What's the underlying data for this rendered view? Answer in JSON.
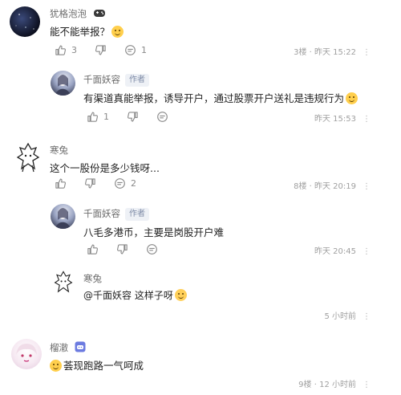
{
  "comments": [
    {
      "name": "犹格泡泡",
      "text": "能不能举报？",
      "likes": "3",
      "replies": "1",
      "floor": "3楼",
      "time": "昨天 15:22",
      "more": "⋮"
    },
    {
      "name": "千面妖容",
      "tag": "作者",
      "text": "有渠道真能举报，诱导开户，通过股票开户送礼是违规行为",
      "likes": "1",
      "time": "昨天 15:53",
      "more": "⋮"
    },
    {
      "name": "寒兔",
      "text": "这个一股份是多少钱呀...",
      "replies": "2",
      "floor": "8楼",
      "time": "昨天 20:19",
      "more": "⋮"
    },
    {
      "name": "千面妖容",
      "tag": "作者",
      "text": "八毛多港币，主要是岗股开户难",
      "time": "昨天 20:45",
      "more": "⋮"
    },
    {
      "name": "寒兔",
      "mention": "@千面妖容",
      "text": " 这样子呀",
      "time": "5 小时前",
      "more": "⋮"
    },
    {
      "name": "榴澈",
      "text": "荟现跑路一气呵成",
      "floor": "9楼",
      "time": "12 小时前",
      "more": "⋮"
    }
  ],
  "colors": {
    "text": "#222222",
    "muted": "#8a8a8a",
    "author_tag_bg": "#eef1f6",
    "author_tag_fg": "#7d8aa6",
    "emoji": "#ffcf4d"
  },
  "icons": [
    "thumb-up-icon",
    "thumb-down-icon",
    "comment-bubble-icon",
    "emoji-icon",
    "game-controller-icon",
    "user-badge-icon"
  ]
}
